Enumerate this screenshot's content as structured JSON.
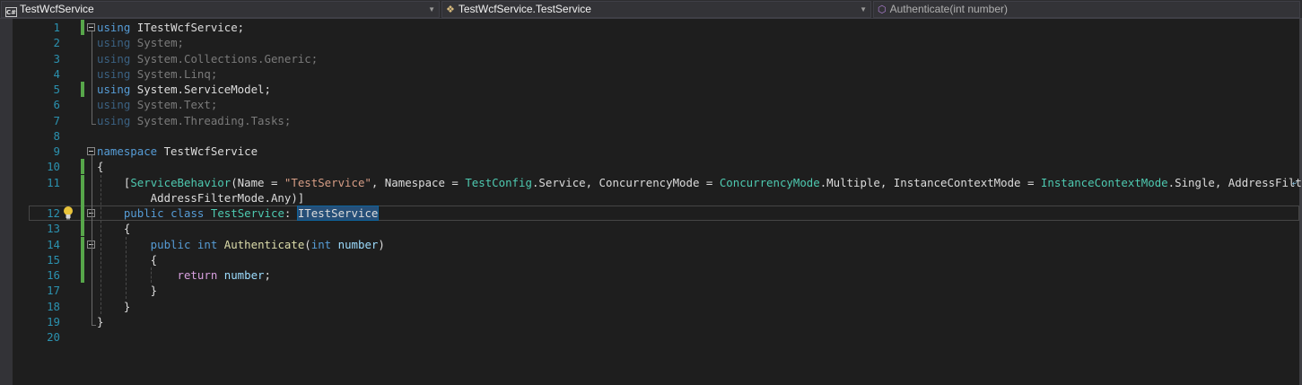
{
  "navbar": {
    "project": "TestWcfService",
    "project_icon": "C#",
    "type": "TestWcfService.TestService",
    "member": "Authenticate(int number)"
  },
  "icons": {
    "project": "csharp-project-icon",
    "type": "class-icon",
    "member": "method-icon",
    "dropdown": "chevron-down-icon",
    "quick_actions": "lightbulb-icon",
    "fold": "collapse-icon",
    "overflow": "line-continuation-icon"
  },
  "colors": {
    "background": "#1e1e1e",
    "keyword": "#569cd6",
    "type": "#4ec9b0",
    "string": "#d69d85",
    "line_number": "#2b91af",
    "change_marker": "#57a64a"
  },
  "editor": {
    "lines": [
      {
        "n": "1",
        "tokens": [
          [
            "kw",
            "using"
          ],
          [
            "p",
            " ITestWcfService;"
          ]
        ]
      },
      {
        "n": "2",
        "tokens": [
          [
            "kwd",
            "using"
          ],
          [
            "pd",
            " System;"
          ]
        ]
      },
      {
        "n": "3",
        "tokens": [
          [
            "kwd",
            "using"
          ],
          [
            "pd",
            " System.Collections.Generic;"
          ]
        ]
      },
      {
        "n": "4",
        "tokens": [
          [
            "kwd",
            "using"
          ],
          [
            "pd",
            " System.Linq;"
          ]
        ]
      },
      {
        "n": "5",
        "tokens": [
          [
            "kw",
            "using"
          ],
          [
            "p",
            " System.ServiceModel;"
          ]
        ]
      },
      {
        "n": "6",
        "tokens": [
          [
            "kwd",
            "using"
          ],
          [
            "pd",
            " System.Text;"
          ]
        ]
      },
      {
        "n": "7",
        "tokens": [
          [
            "kwd",
            "using"
          ],
          [
            "pd",
            " System.Threading.Tasks;"
          ]
        ]
      },
      {
        "n": "8",
        "tokens": []
      },
      {
        "n": "9",
        "tokens": [
          [
            "kw",
            "namespace"
          ],
          [
            "p",
            " TestWcfService"
          ]
        ]
      },
      {
        "n": "10",
        "tokens": [
          [
            "p",
            "{"
          ]
        ]
      },
      {
        "n": "11",
        "tokens": [
          [
            "p",
            "    ["
          ],
          [
            "ty",
            "ServiceBehavior"
          ],
          [
            "p",
            "(Name = "
          ],
          [
            "str",
            "\"TestService\""
          ],
          [
            "p",
            ", Namespace = "
          ],
          [
            "ty",
            "TestConfig"
          ],
          [
            "p",
            ".Service, ConcurrencyMode = "
          ],
          [
            "ty",
            "ConcurrencyMode"
          ],
          [
            "p",
            ".Multiple, InstanceContextMode = "
          ],
          [
            "ty",
            "InstanceContextMode"
          ],
          [
            "p",
            ".Single, AddressFilterMode = "
          ]
        ]
      },
      {
        "n": "",
        "tokens": [
          [
            "p",
            "        AddressFilterMode.Any)]"
          ]
        ]
      },
      {
        "n": "12",
        "tokens": [
          [
            "kw",
            "    public"
          ],
          [
            "p",
            " "
          ],
          [
            "kw",
            "class"
          ],
          [
            "p",
            " "
          ],
          [
            "ty",
            "TestService"
          ],
          [
            "p",
            ": "
          ],
          [
            "sel",
            "ITestService"
          ]
        ]
      },
      {
        "n": "13",
        "tokens": [
          [
            "p",
            "    {"
          ]
        ]
      },
      {
        "n": "14",
        "tokens": [
          [
            "kw",
            "        public"
          ],
          [
            "p",
            " "
          ],
          [
            "kw",
            "int"
          ],
          [
            "p",
            " "
          ],
          [
            "meth",
            "Authenticate"
          ],
          [
            "p",
            "("
          ],
          [
            "kw",
            "int"
          ],
          [
            "p",
            " "
          ],
          [
            "param",
            "number"
          ],
          [
            "p",
            ")"
          ]
        ]
      },
      {
        "n": "15",
        "tokens": [
          [
            "p",
            "        {"
          ]
        ]
      },
      {
        "n": "16",
        "tokens": [
          [
            "ctrl",
            "            return"
          ],
          [
            "p",
            " "
          ],
          [
            "param",
            "number"
          ],
          [
            "p",
            ";"
          ]
        ]
      },
      {
        "n": "17",
        "tokens": [
          [
            "p",
            "        }"
          ]
        ]
      },
      {
        "n": "18",
        "tokens": [
          [
            "p",
            "    }"
          ]
        ]
      },
      {
        "n": "19",
        "tokens": [
          [
            "p",
            "}"
          ]
        ]
      },
      {
        "n": "20",
        "tokens": []
      }
    ]
  }
}
